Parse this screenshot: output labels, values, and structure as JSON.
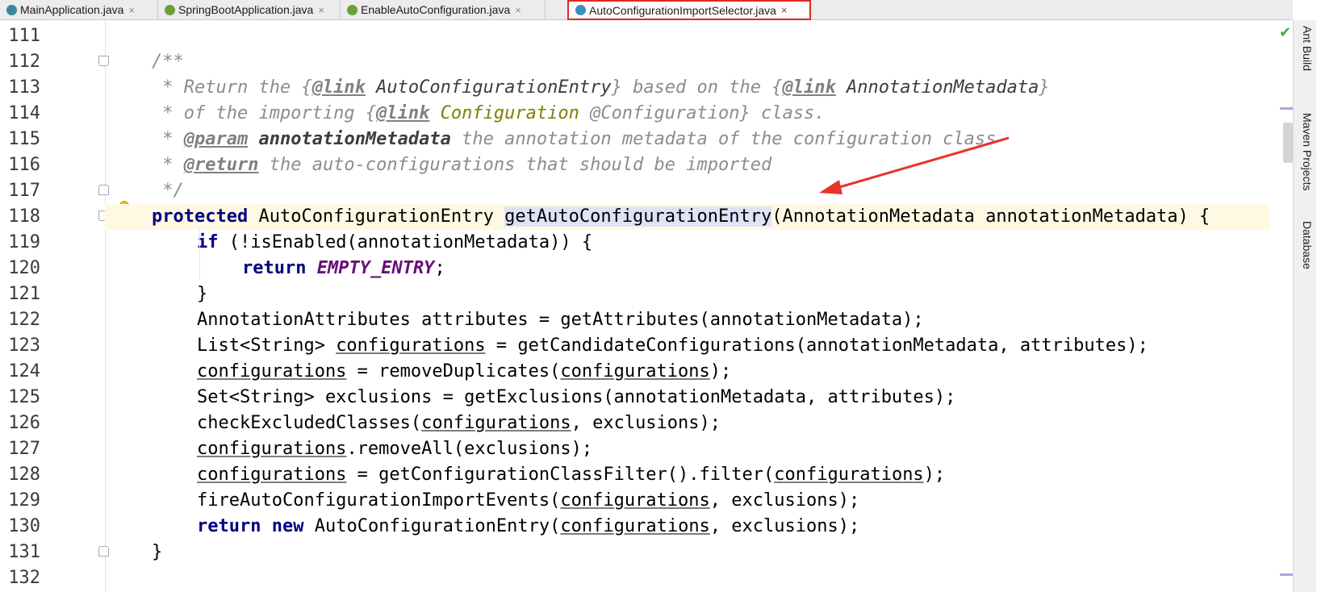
{
  "tabs": [
    {
      "label": "MainApplication.java",
      "icon": "java-class-icon",
      "active": false
    },
    {
      "label": "SpringBootApplication.java",
      "icon": "annotation-icon",
      "active": false
    },
    {
      "label": "EnableAutoConfiguration.java",
      "icon": "annotation-icon",
      "active": false
    },
    {
      "label": "AutoConfigurationImportSelector.java",
      "icon": "class-icon",
      "active": true
    }
  ],
  "close_glyph": "×",
  "tool_windows": [
    "Ant Build",
    "Maven Projects",
    "Database"
  ],
  "line_numbers": [
    "111",
    "112",
    "113",
    "114",
    "115",
    "116",
    "117",
    "118",
    "119",
    "120",
    "121",
    "122",
    "123",
    "124",
    "125",
    "126",
    "127",
    "128",
    "129",
    "130",
    "131",
    "132"
  ],
  "code": {
    "l112": "/**",
    "l113": {
      "a": " * Return the {",
      "tag1": "@link",
      "b": " ",
      "ref1": "AutoConfigurationEntry",
      "c": "} based on the {",
      "tag2": "@link",
      "d": " ",
      "ref2": "AnnotationMetadata",
      "e": "}"
    },
    "l114": {
      "a": " * of the importing {",
      "tag": "@link",
      "b": " ",
      "ref": "Configuration",
      "c": " @Configuration} class."
    },
    "l115": {
      "a": " * ",
      "tag": "@param",
      "b": " ",
      "name": "annotationMetadata",
      "c": " the annotation metadata of the configuration class"
    },
    "l116": {
      "a": " * ",
      "tag": "@return",
      "b": " the auto-configurations that should be imported"
    },
    "l117": " */",
    "l118": {
      "kw": "protected",
      "a": " AutoConfigurationEntry ",
      "method": "getAutoConfigurationEntry",
      "b": "(AnnotationMetadata annotationMetadata) {"
    },
    "l119": {
      "kw": "if",
      "a": " (!isEnabled(annotationMetadata)) {"
    },
    "l120": {
      "kw": "return",
      "a": " ",
      "const": "EMPTY_ENTRY",
      "b": ";"
    },
    "l121": "}",
    "l122": "AnnotationAttributes attributes = getAttributes(annotationMetadata);",
    "l123": {
      "a": "List<String> ",
      "var": "configurations",
      "b": " = getCandidateConfigurations(annotationMetadata, attributes);"
    },
    "l124": {
      "var1": "configurations",
      "a": " = removeDuplicates(",
      "var2": "configurations",
      "b": ");"
    },
    "l125": "Set<String> exclusions = getExclusions(annotationMetadata, attributes);",
    "l126": {
      "a": "checkExcludedClasses(",
      "var": "configurations",
      "b": ", exclusions);"
    },
    "l127": {
      "var": "configurations",
      "a": ".removeAll(exclusions);"
    },
    "l128": {
      "var1": "configurations",
      "a": " = getConfigurationClassFilter().filter(",
      "var2": "configurations",
      "b": ");"
    },
    "l129": {
      "a": "fireAutoConfigurationImportEvents(",
      "var": "configurations",
      "b": ", exclusions);"
    },
    "l130": {
      "kw1": "return",
      "a": " ",
      "kw2": "new",
      "b": " AutoConfigurationEntry(",
      "var": "configurations",
      "c": ", exclusions);"
    },
    "l131": "}"
  },
  "colors": {
    "arrow": "#e8342b",
    "tab_highlight": "#e0291e",
    "current_line": "#fff9e3"
  }
}
